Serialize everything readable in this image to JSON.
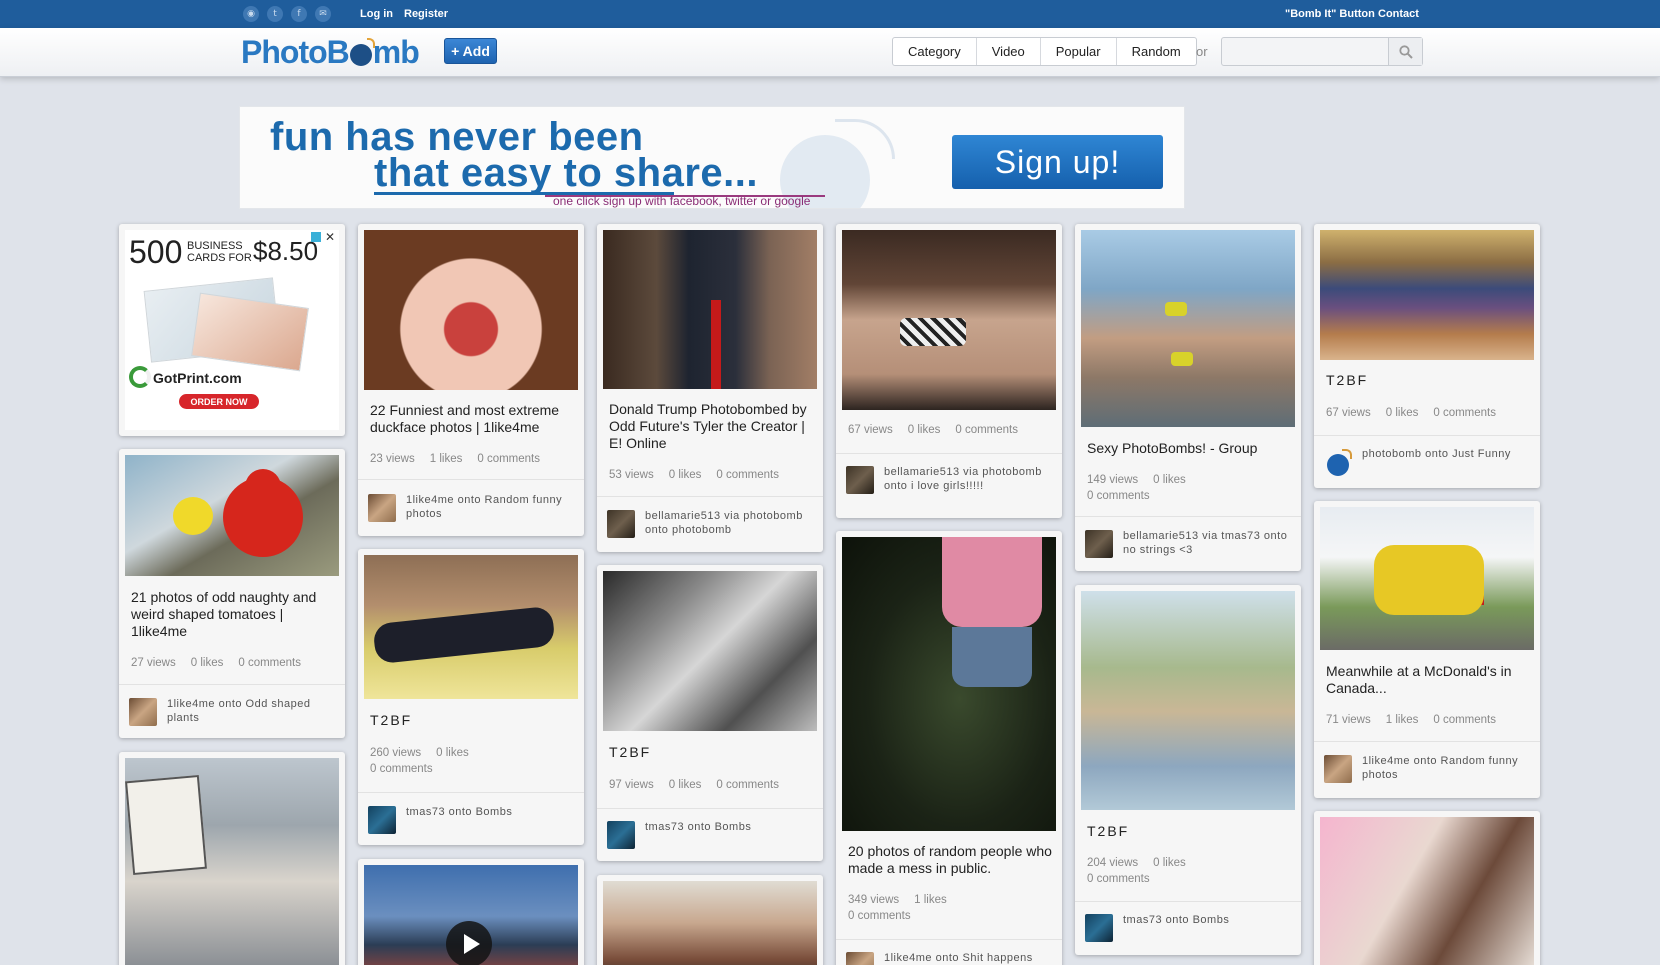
{
  "topbar": {
    "social_icons": [
      {
        "name": "rss-icon",
        "glyph": "◉"
      },
      {
        "name": "twitter-icon",
        "glyph": "t"
      },
      {
        "name": "facebook-icon",
        "glyph": "f"
      },
      {
        "name": "email-icon",
        "glyph": "✉"
      }
    ],
    "login": "Log in",
    "register": "Register",
    "bomb_it": "\"Bomb It\" Button",
    "contact": "Contact"
  },
  "header": {
    "logo_pre": "PhotoB",
    "logo_post": "mb",
    "add_label": "+ Add",
    "nav": [
      "Category",
      "Video",
      "Popular",
      "Random"
    ],
    "or": "or",
    "search_placeholder": ""
  },
  "banner": {
    "line1": "fun has never been",
    "line2": "that easy to share...",
    "line3": "one click sign up with facebook, twitter or google",
    "signup": "Sign up!"
  },
  "ad": {
    "big": "500",
    "business": "BUSINESS",
    "cards_for": "CARDS FOR",
    "price": "$8.50",
    "brand": "GotPrint.com",
    "order": "ORDER NOW",
    "close": "✕"
  },
  "cards": [
    {
      "title": "21 photos of odd naughty and weird shaped tomatoes | 1like4me",
      "views": "27 views",
      "likes": "0 likes",
      "comments": "0 comments",
      "by": "1like4me onto Odd shaped plants"
    },
    {
      "title": "",
      "views": "",
      "likes": "",
      "comments": "",
      "by": ""
    },
    {
      "title": "22 Funniest and most extreme duckface photos | 1like4me",
      "views": "23 views",
      "likes": "1 likes",
      "comments": "0 comments",
      "by": "1like4me onto Random funny photos"
    },
    {
      "title": "T2BF",
      "views": "260 views",
      "likes": "0 likes",
      "comments": "0 comments",
      "by": "tmas73 onto Bombs"
    },
    {
      "title": "",
      "views": "",
      "likes": "",
      "comments": "",
      "by": ""
    },
    {
      "title": "Donald Trump Photobombed by Odd Future's Tyler the Creator | E! Online",
      "views": "53 views",
      "likes": "0 likes",
      "comments": "0 comments",
      "by": "bellamarie513 via photobomb onto photobomb"
    },
    {
      "title": "T2BF",
      "views": "97 views",
      "likes": "0 likes",
      "comments": "0 comments",
      "by": "tmas73 onto Bombs"
    },
    {
      "title": "",
      "views": "",
      "likes": "",
      "comments": "",
      "by": ""
    },
    {
      "title": "",
      "views": "67 views",
      "likes": "0 likes",
      "comments": "0 comments",
      "by": "bellamarie513 via photobomb onto i love girls!!!!!"
    },
    {
      "title": "20 photos of random people who made a mess in public.",
      "views": "349 views",
      "likes": "1 likes",
      "comments": "0 comments",
      "by": "1like4me onto Shit happens"
    },
    {
      "title": "Sexy PhotoBombs! - Group",
      "views": "149 views",
      "likes": "0 likes",
      "comments": "0 comments",
      "by": "bellamarie513 via tmas73 onto no strings <3"
    },
    {
      "title": "T2BF",
      "views": "204 views",
      "likes": "0 likes",
      "comments": "0 comments",
      "by": "tmas73 onto Bombs"
    },
    {
      "title": "T2BF",
      "views": "67 views",
      "likes": "0 likes",
      "comments": "0 comments",
      "by": "photobomb onto Just Funny"
    },
    {
      "title": "Meanwhile at a McDonald's in Canada...",
      "views": "71 views",
      "likes": "1 likes",
      "comments": "0 comments",
      "by": "1like4me onto Random funny photos"
    },
    {
      "title": "",
      "views": "",
      "likes": "",
      "comments": "",
      "by": ""
    }
  ]
}
